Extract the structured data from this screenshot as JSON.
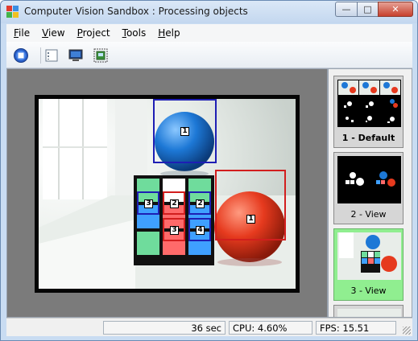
{
  "window": {
    "title": "Computer Vision Sandbox : Processing objects",
    "controls": {
      "minimize": "—",
      "maximize": "□",
      "close": "✕"
    }
  },
  "menu": [
    "File",
    "View",
    "Project",
    "Tools",
    "Help"
  ],
  "toolbar": {
    "buttons": [
      {
        "name": "stop-icon"
      },
      {
        "name": "properties-icon"
      },
      {
        "name": "full-screen-icon"
      },
      {
        "name": "snapshot-icon"
      }
    ]
  },
  "video": {
    "detections": [
      {
        "label": "1",
        "color": "#1e1eb4",
        "object": "blue ball"
      },
      {
        "label": "1",
        "color": "#d21e1e",
        "object": "red ball"
      },
      {
        "label": "3",
        "color": "#1e1eb4"
      },
      {
        "label": "2",
        "color": "#d21e1e"
      },
      {
        "label": "2",
        "color": "#1e1eb4"
      },
      {
        "label": "3",
        "color": "#d21e1e"
      },
      {
        "label": "4",
        "color": "#1e1eb4"
      }
    ]
  },
  "views": [
    {
      "label": "1 - Default",
      "active": false,
      "bold": true
    },
    {
      "label": "2 - View",
      "active": false,
      "bold": false
    },
    {
      "label": "3 - View",
      "active": true,
      "bold": false
    }
  ],
  "status": {
    "time": "36 sec",
    "cpu": "CPU: 4.60%",
    "fps": "FPS: 15.51"
  },
  "colors": {
    "active_view": "#90ee90",
    "blue_box": "#1e1eb4",
    "red_box": "#d21e1e"
  }
}
